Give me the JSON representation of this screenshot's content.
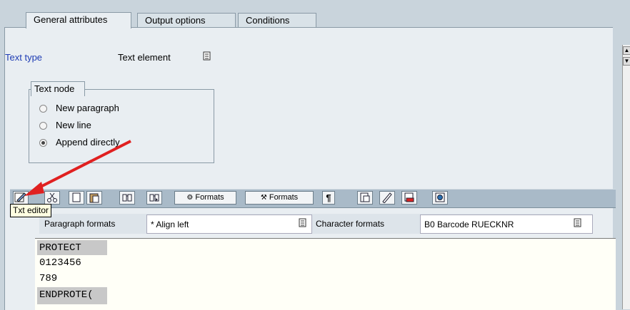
{
  "tabs": [
    {
      "label": "General attributes"
    },
    {
      "label": "Output options"
    },
    {
      "label": "Conditions"
    }
  ],
  "text_type": {
    "label": "Text type",
    "value": "Text element"
  },
  "text_node": {
    "title": "Text node",
    "options": [
      {
        "label": "New paragraph",
        "selected": false
      },
      {
        "label": "New line",
        "selected": false
      },
      {
        "label": "Append directly",
        "selected": true
      }
    ]
  },
  "toolbar": {
    "formats1": "Formats",
    "formats2": "Formats",
    "tooltip": "Txt editor",
    "icons": [
      "txt-editor-icon",
      "cut-icon",
      "copy-icon",
      "paste-icon",
      "find-icon",
      "find-next-icon",
      "pilcrow-icon",
      "insert-icon",
      "pencil-icon",
      "fill-icon",
      "preview-icon"
    ]
  },
  "format_bar": {
    "paragraph_label": "Paragraph formats",
    "paragraph_value": "* Align left",
    "character_label": "Character formats",
    "character_value": "B0 Barcode RUECKNR"
  },
  "editor_lines": [
    "PROTECT",
    "0123456",
    "789",
    "ENDPROTE("
  ],
  "colors": {
    "accent_label": "#1e3cb4",
    "annotation_arrow": "#e02020"
  }
}
